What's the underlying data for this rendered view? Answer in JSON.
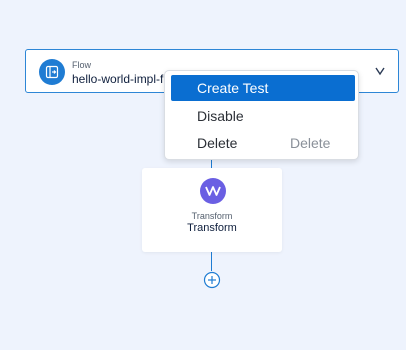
{
  "flow": {
    "kind_label": "Flow",
    "name": "hello-world-impl-flow",
    "icon": "flow-icon",
    "accent": "#1f7cd3"
  },
  "context_menu": {
    "items": [
      {
        "label": "Create Test",
        "shortcut": "",
        "highlighted": true
      },
      {
        "label": "Disable",
        "shortcut": ""
      },
      {
        "label": "Delete",
        "shortcut": "Delete"
      }
    ]
  },
  "transform": {
    "kind_label": "Transform",
    "name": "Transform",
    "icon": "transform-icon",
    "accent": "#6a5fe3"
  },
  "add_step": {
    "icon": "plus-circle-icon"
  }
}
